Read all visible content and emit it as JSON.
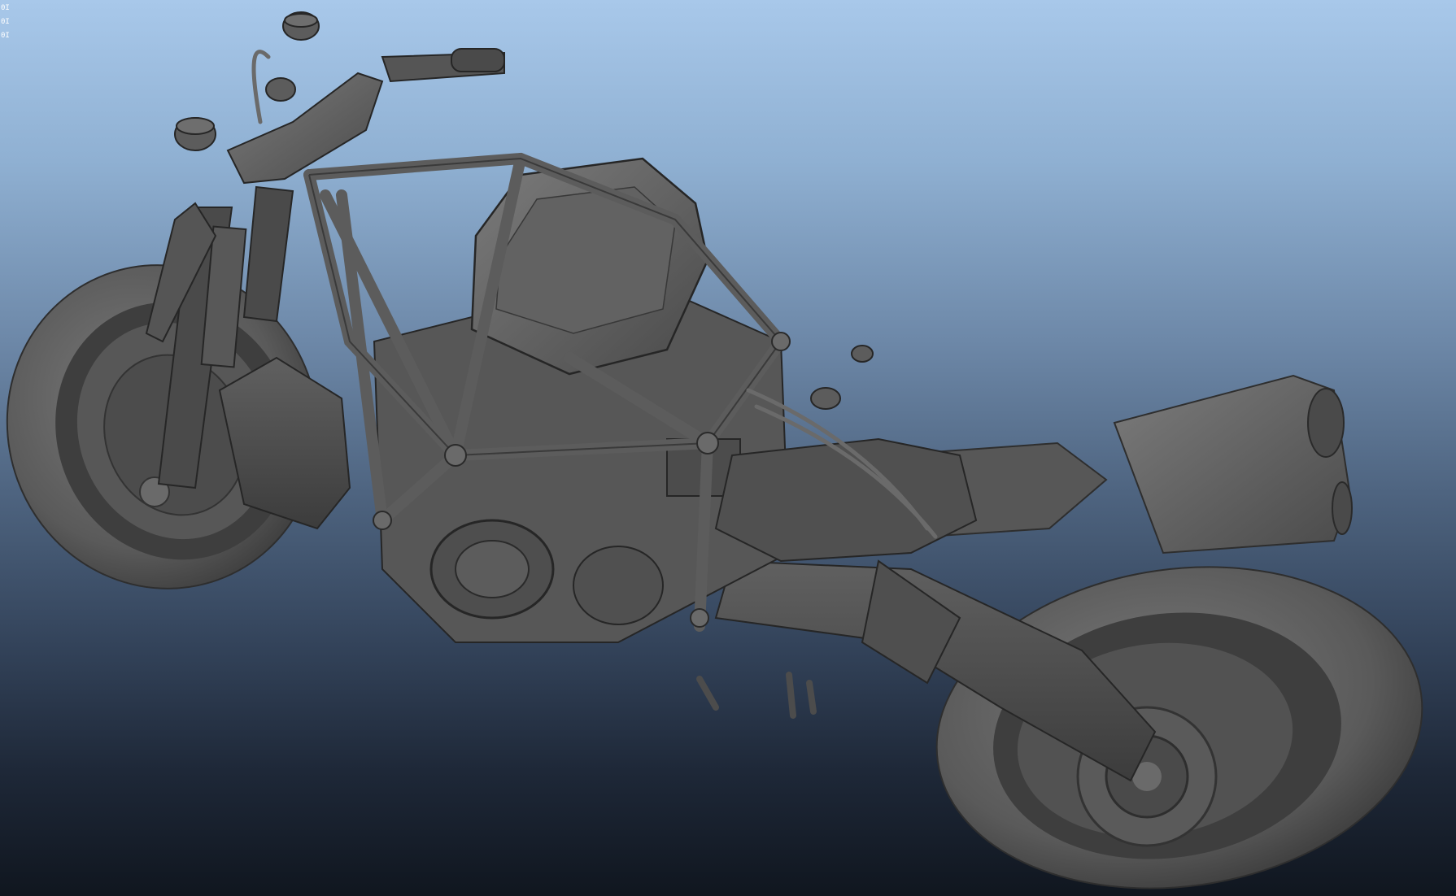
{
  "viewport": {
    "hud_lines": [
      "0I",
      "0I",
      "0I"
    ]
  },
  "colors": {
    "background_top": "#a8c8ea",
    "background_bottom": "#10161f",
    "model_shade": "#5e5e5e"
  }
}
